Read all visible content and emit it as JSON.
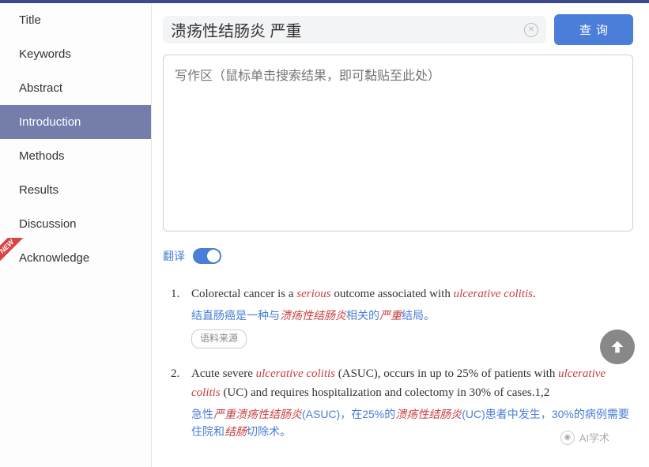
{
  "sidebar": {
    "items": [
      {
        "label": "Title"
      },
      {
        "label": "Keywords"
      },
      {
        "label": "Abstract"
      },
      {
        "label": "Introduction"
      },
      {
        "label": "Methods"
      },
      {
        "label": "Results"
      },
      {
        "label": "Discussion"
      },
      {
        "label": "Acknowledge"
      }
    ]
  },
  "search": {
    "value": "溃疡性结肠炎 严重",
    "button": "查询"
  },
  "writing_area": {
    "placeholder": "写作区（鼠标单击搜索结果，即可黏贴至此处）"
  },
  "toggle": {
    "label": "翻译"
  },
  "results": [
    {
      "num": "1.",
      "en_plain": "Colorectal cancer is a ",
      "en_hl1": "serious",
      "en_mid": " outcome associated with ",
      "en_hl2": "ulcerative colitis",
      "en_end": ".",
      "cn_pre": "结直肠癌是一种与",
      "cn_hl1": "溃疡性结肠炎",
      "cn_mid": "相关的",
      "cn_hl2": "严重",
      "cn_end": "结局。",
      "source": "语料来源"
    },
    {
      "num": "2.",
      "en_pre": "Acute severe ",
      "en_hl1": "ulcerative colitis",
      "en_mid1": " (ASUC), occurs in up to 25% of patients with ",
      "en_hl2": "ulcerative colitis",
      "en_mid2": " (UC) and requires hospitalization and colectomy in 30% of cases.1,2",
      "cn_pre": "急性",
      "cn_hl1": "严重溃疡性结肠炎",
      "cn_mid1": "(ASUC)，在25%的",
      "cn_hl2": "溃疡性结肠炎",
      "cn_mid2": "(UC)患者中发生，30%的病例需要住院和",
      "cn_hl3": "结肠",
      "cn_end": "切除术。"
    }
  ],
  "watermark": "AI学术"
}
